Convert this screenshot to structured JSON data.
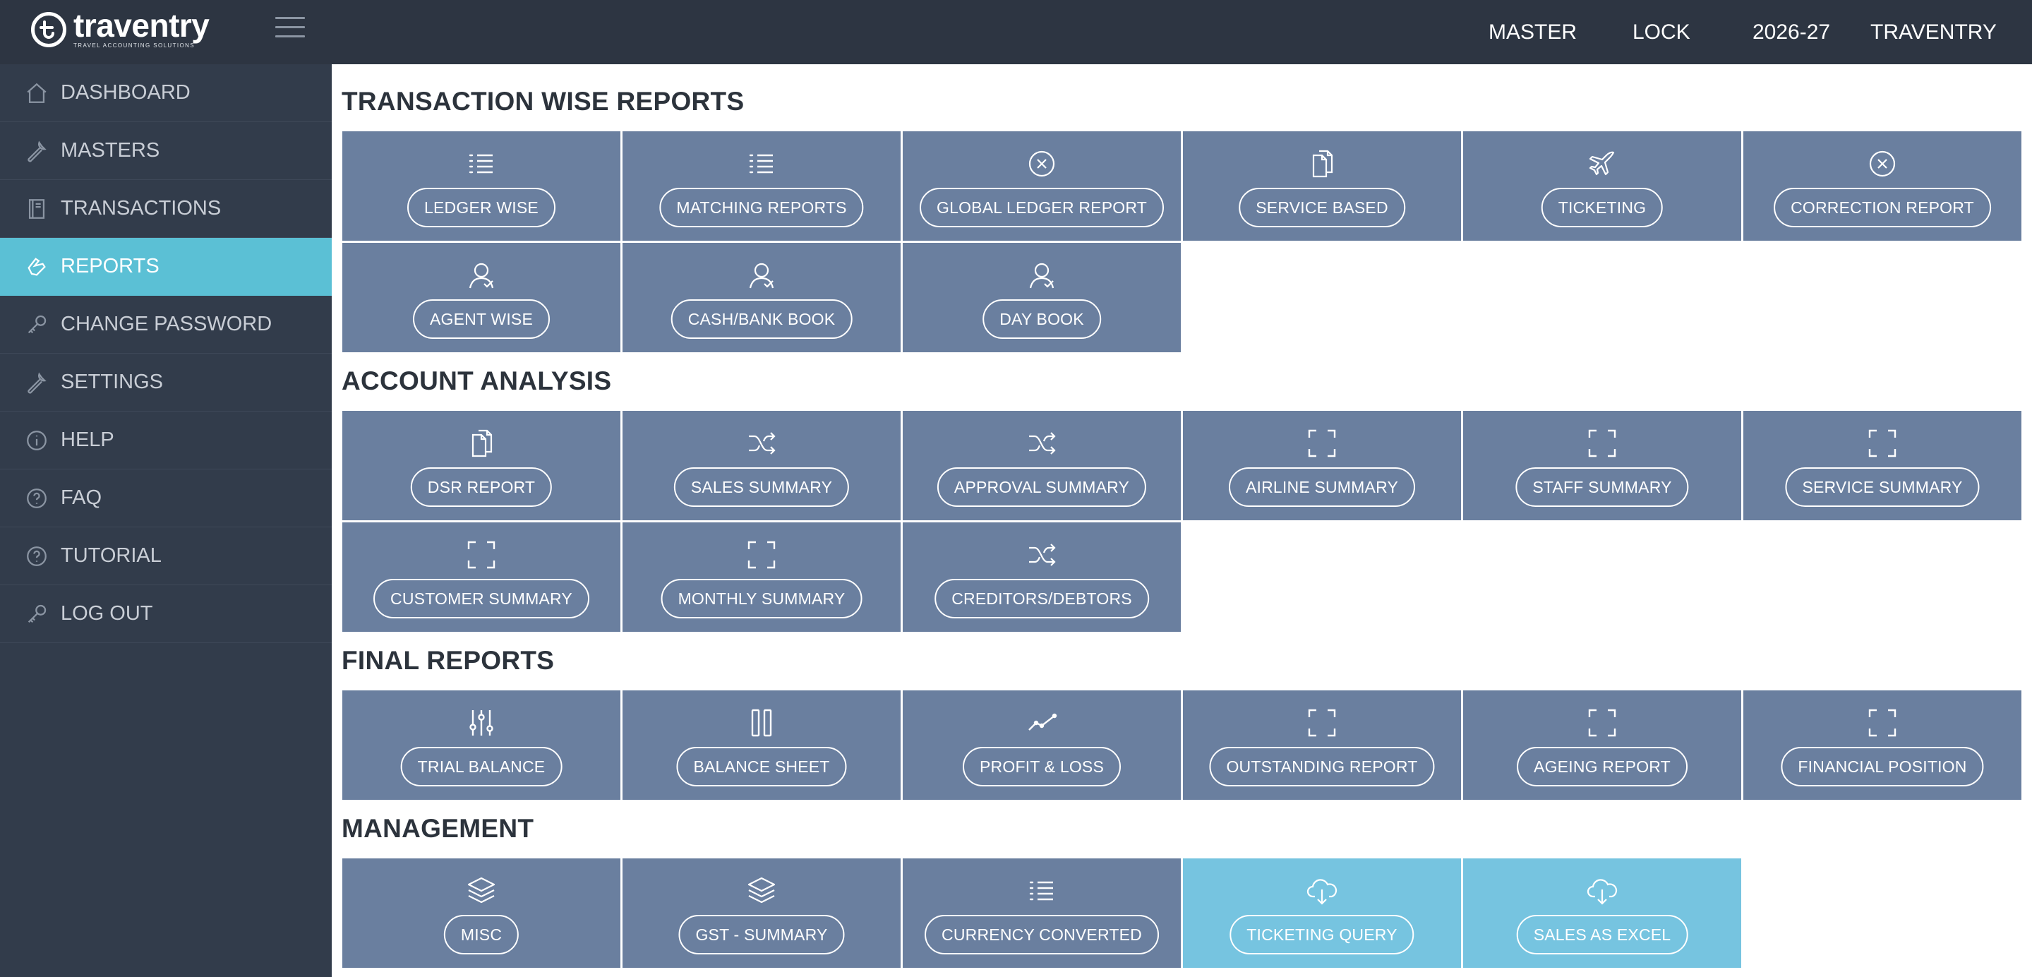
{
  "brand": {
    "name": "traventry",
    "tagline": "TRAVEL ACCOUNTING SOLUTIONS"
  },
  "top_nav": {
    "master": "MASTER",
    "lock": "LOCK",
    "year": "2026-27",
    "company": "TRAVENTRY"
  },
  "sidebar": {
    "items": [
      {
        "label": "DASHBOARD",
        "icon": "home-icon"
      },
      {
        "label": "MASTERS",
        "icon": "wrench-icon"
      },
      {
        "label": "TRANSACTIONS",
        "icon": "book-icon"
      },
      {
        "label": "REPORTS",
        "icon": "hand-icon",
        "active": true
      },
      {
        "label": "CHANGE PASSWORD",
        "icon": "key-icon"
      },
      {
        "label": "SETTINGS",
        "icon": "wrench-icon"
      },
      {
        "label": "HELP",
        "icon": "info-icon"
      },
      {
        "label": "FAQ",
        "icon": "question-icon"
      },
      {
        "label": "TUTORIAL",
        "icon": "question-icon"
      },
      {
        "label": "LOG OUT",
        "icon": "key-icon"
      }
    ]
  },
  "sections": {
    "transaction_wise": {
      "title": "TRANSACTION WISE REPORTS",
      "tiles": [
        {
          "label": "LEDGER WISE",
          "icon": "list-icon"
        },
        {
          "label": "MATCHING REPORTS",
          "icon": "list-icon"
        },
        {
          "label": "GLOBAL LEDGER REPORT",
          "icon": "close-circle-icon"
        },
        {
          "label": "SERVICE BASED",
          "icon": "documents-icon"
        },
        {
          "label": "TICKETING",
          "icon": "plane-icon"
        },
        {
          "label": "CORRECTION REPORT",
          "icon": "close-circle-icon"
        },
        {
          "label": "AGENT WISE",
          "icon": "user-icon"
        },
        {
          "label": "CASH/BANK BOOK",
          "icon": "user-icon"
        },
        {
          "label": "DAY BOOK",
          "icon": "user-icon"
        }
      ]
    },
    "account_analysis": {
      "title": "ACCOUNT ANALYSIS",
      "tiles": [
        {
          "label": "DSR REPORT",
          "icon": "documents-icon"
        },
        {
          "label": "SALES SUMMARY",
          "icon": "shuffle-icon"
        },
        {
          "label": "APPROVAL SUMMARY",
          "icon": "shuffle-icon"
        },
        {
          "label": "AIRLINE SUMMARY",
          "icon": "frame-icon"
        },
        {
          "label": "STAFF SUMMARY",
          "icon": "frame-icon"
        },
        {
          "label": "SERVICE SUMMARY",
          "icon": "frame-icon"
        },
        {
          "label": "CUSTOMER SUMMARY",
          "icon": "frame-icon"
        },
        {
          "label": "MONTHLY SUMMARY",
          "icon": "frame-icon"
        },
        {
          "label": "CREDITORS/DEBTORS",
          "icon": "shuffle-icon"
        }
      ]
    },
    "final_reports": {
      "title": "FINAL REPORTS",
      "tiles": [
        {
          "label": "TRIAL BALANCE",
          "icon": "sliders-icon"
        },
        {
          "label": "BALANCE SHEET",
          "icon": "columns-icon"
        },
        {
          "label": "PROFIT & LOSS",
          "icon": "trend-icon"
        },
        {
          "label": "OUTSTANDING REPORT",
          "icon": "frame-icon"
        },
        {
          "label": "AGEING REPORT",
          "icon": "frame-icon"
        },
        {
          "label": "FINANCIAL POSITION",
          "icon": "frame-icon"
        }
      ]
    },
    "management": {
      "title": "MANAGEMENT",
      "tiles": [
        {
          "label": "MISC",
          "icon": "layers-icon"
        },
        {
          "label": "GST - SUMMARY",
          "icon": "layers-icon"
        },
        {
          "label": "CURRENCY CONVERTED",
          "icon": "list-icon"
        },
        {
          "label": "TICKETING QUERY",
          "icon": "cloud-download-icon",
          "highlight": true
        },
        {
          "label": "SALES AS EXCEL",
          "icon": "cloud-download-icon",
          "highlight": true
        }
      ]
    }
  },
  "colors": {
    "topbar": "#2d3542",
    "sidebar": "#323c4b",
    "sidebar_active": "#5bc0d5",
    "tile": "#6a7f9f",
    "tile_highlight": "#76c4e0"
  }
}
